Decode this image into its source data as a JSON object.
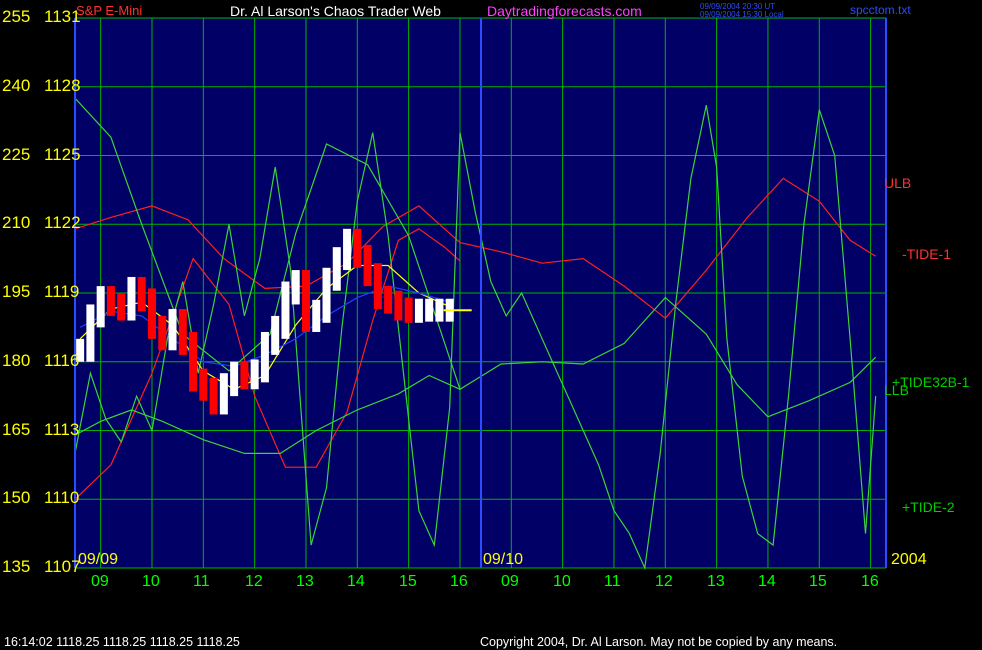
{
  "header": {
    "instrument": "S&P E-Mini",
    "title": "Dr. Al Larson's Chaos Trader Web",
    "site": "Daytradingforecasts.com",
    "stamp_line1": "09/09/2004 20:30 UT",
    "stamp_line2": "09/09/2004 15:30 Local",
    "filename": "spcctom.txt"
  },
  "footer": {
    "quote": "16:14:02  1118.25 1118.25 1118.25 1118.25",
    "copyright": "Copyright 2004, Dr. Al Larson. May not be copied by any means."
  },
  "colors": {
    "background": "#000000",
    "plot_area": "#000066",
    "grid": "#00b400",
    "tick_labels": "#ffff00",
    "time_labels": "#00ff00",
    "price_bars_up": "#ffffff",
    "price_bars_down": "#ff0000",
    "band": "#ff2020",
    "tide": "#3cd23c",
    "moving_avg": "#ffff00",
    "blue_line": "#2040ff"
  },
  "chart_data": {
    "type": "line",
    "title": "Dr. Al Larson's Chaos Trader Web",
    "y_label_pairs": [
      {
        "left": "255",
        "price": "1131"
      },
      {
        "left": "240",
        "price": "1128"
      },
      {
        "left": "225",
        "price": "1125"
      },
      {
        "left": "210",
        "price": "1122"
      },
      {
        "left": "195",
        "price": "1119"
      },
      {
        "left": "180",
        "price": "1116"
      },
      {
        "left": "165",
        "price": "1113"
      },
      {
        "left": "150",
        "price": "1110"
      },
      {
        "left": "135",
        "price": "1107"
      }
    ],
    "ylim": [
      1107,
      1131
    ],
    "xlim": [
      8.5,
      24.3
    ],
    "x_tick_labels": [
      {
        "x": 9,
        "label": "09"
      },
      {
        "x": 10,
        "label": "10"
      },
      {
        "x": 11,
        "label": "11"
      },
      {
        "x": 12,
        "label": "12"
      },
      {
        "x": 13,
        "label": "13"
      },
      {
        "x": 14,
        "label": "14"
      },
      {
        "x": 15,
        "label": "15"
      },
      {
        "x": 16,
        "label": "16"
      },
      {
        "x": 17,
        "label": "09"
      },
      {
        "x": 18,
        "label": "10"
      },
      {
        "x": 19,
        "label": "11"
      },
      {
        "x": 20,
        "label": "12"
      },
      {
        "x": 21,
        "label": "13"
      },
      {
        "x": 22,
        "label": "14"
      },
      {
        "x": 23,
        "label": "15"
      },
      {
        "x": 24,
        "label": "16"
      }
    ],
    "date_labels": {
      "day1": "09/09",
      "day2": "09/10",
      "year": "2004"
    },
    "day_divider_x": 16,
    "current_price": 1118.25,
    "price_bars": {
      "x": [
        8.6,
        8.8,
        9.0,
        9.2,
        9.4,
        9.6,
        9.8,
        10.0,
        10.2,
        10.4,
        10.6,
        10.8,
        11.0,
        11.2,
        11.4,
        11.6,
        11.8,
        12.0,
        12.2,
        12.4,
        12.6,
        12.8,
        13.0,
        13.2,
        13.4,
        13.6,
        13.8,
        14.0,
        14.2,
        14.4,
        14.6,
        14.8,
        15.0,
        15.2,
        15.4,
        15.6,
        15.8
      ],
      "close": [
        1116.5,
        1118.0,
        1118.8,
        1118.5,
        1118.3,
        1119.2,
        1118.7,
        1117.5,
        1117.0,
        1117.8,
        1116.8,
        1115.2,
        1114.8,
        1114.2,
        1115.0,
        1115.5,
        1115.3,
        1115.6,
        1116.8,
        1117.5,
        1119.0,
        1119.5,
        1117.8,
        1118.2,
        1119.6,
        1120.5,
        1121.3,
        1120.6,
        1119.8,
        1118.8,
        1118.6,
        1118.3,
        1118.2,
        1118.25,
        1118.25,
        1118.25,
        1118.25
      ]
    },
    "series": [
      {
        "name": "ULB",
        "x": [
          8.5,
          9.2,
          10.0,
          10.7,
          11.4,
          12.2,
          13.0,
          13.8,
          14.5,
          15.2,
          16.0,
          16.8,
          17.6,
          18.4,
          19.2,
          20.0,
          20.8,
          21.6,
          22.3,
          23.0,
          23.6,
          24.1
        ],
        "y": [
          1121.8,
          1122.3,
          1122.8,
          1122.2,
          1120.5,
          1119.2,
          1119.3,
          1120.3,
          1121.9,
          1122.8,
          1121.2,
          1120.8,
          1120.3,
          1120.5,
          1119.3,
          1117.9,
          1120.0,
          1122.3,
          1124.0,
          1123.0,
          1121.3,
          1120.6
        ]
      },
      {
        "name": "LLB",
        "x": [
          8.5,
          9.2,
          10.0,
          10.8,
          11.5,
          12.0,
          12.6,
          13.2,
          13.8,
          14.3,
          14.8,
          15.2,
          15.7,
          16.0
        ],
        "y": [
          1110.0,
          1111.5,
          1115.5,
          1120.5,
          1118.5,
          1114.5,
          1111.4,
          1111.4,
          1113.8,
          1117.8,
          1121.3,
          1121.8,
          1121.0,
          1120.4
        ]
      },
      {
        "name": "-TIDE-1",
        "x": [
          8.5,
          9.2,
          9.8,
          10.6,
          11.5,
          12.3,
          12.8,
          13.4,
          14.2,
          15.0,
          15.6,
          16.0,
          16.8,
          17.6,
          18.4,
          19.2,
          20.0,
          20.8,
          21.4,
          22.0,
          22.8,
          23.6,
          24.1
        ],
        "y": [
          1127.5,
          1125.8,
          1122.0,
          1117.2,
          1115.6,
          1117.2,
          1121.6,
          1125.5,
          1124.6,
          1121.5,
          1117.5,
          1114.8,
          1115.9,
          1116.0,
          1115.9,
          1116.8,
          1118.8,
          1117.2,
          1115.0,
          1113.6,
          1114.3,
          1115.1,
          1116.2
        ]
      },
      {
        "name": "+TIDE-2",
        "x": [
          8.5,
          9.0,
          9.6,
          10.2,
          11.0,
          11.8,
          12.5,
          13.2,
          14.0,
          14.8,
          15.4,
          16.0
        ],
        "y": [
          1112.8,
          1113.4,
          1113.9,
          1113.4,
          1112.6,
          1112.0,
          1112.0,
          1113.0,
          1113.9,
          1114.6,
          1115.4,
          1114.8
        ]
      },
      {
        "name": "+TIDE32B-1",
        "x": [
          8.5,
          8.8,
          9.1,
          9.4,
          9.7,
          10.0,
          10.3,
          10.6,
          10.9,
          11.2,
          11.5,
          11.8,
          12.1,
          12.4,
          12.7,
          12.9,
          13.1,
          13.4,
          13.7,
          14.0,
          14.3,
          14.6,
          14.9,
          15.2,
          15.5,
          15.8,
          16.0,
          16.3,
          16.6,
          16.9,
          17.2,
          17.5,
          17.8,
          18.1,
          18.4,
          18.7,
          19.0,
          19.3,
          19.6,
          19.9,
          20.2,
          20.5,
          20.8,
          21.0,
          21.2,
          21.5,
          21.8,
          22.1,
          22.4,
          22.7,
          23.0,
          23.3,
          23.6,
          23.9,
          24.1
        ],
        "y": [
          1112.0,
          1115.5,
          1113.5,
          1112.5,
          1114.5,
          1113.0,
          1117.0,
          1119.5,
          1115.5,
          1118.5,
          1122.0,
          1118.0,
          1120.5,
          1124.5,
          1120.0,
          1114.0,
          1108.0,
          1110.5,
          1117.5,
          1123.0,
          1126.0,
          1121.5,
          1115.5,
          1109.5,
          1108.0,
          1114.0,
          1126.0,
          1122.5,
          1119.5,
          1118.0,
          1119.0,
          1117.5,
          1116.0,
          1114.5,
          1113.0,
          1111.5,
          1109.5,
          1108.5,
          1107.0,
          1112.0,
          1118.5,
          1124.0,
          1127.2,
          1124.5,
          1117.0,
          1111.0,
          1108.5,
          1108.0,
          1114.5,
          1122.0,
          1127.0,
          1125.0,
          1117.0,
          1108.5,
          1114.5
        ]
      },
      {
        "name": "average",
        "x": [
          8.6,
          9.2,
          9.8,
          10.4,
          11.0,
          11.6,
          12.2,
          12.8,
          13.4,
          14.0,
          14.6,
          15.2,
          15.8
        ],
        "y": [
          1117.0,
          1118.3,
          1118.6,
          1117.6,
          1115.6,
          1114.8,
          1115.4,
          1117.6,
          1119.2,
          1120.2,
          1120.2,
          1119.0,
          1118.4
        ]
      },
      {
        "name": "blue",
        "x": [
          8.6,
          9.2,
          9.8,
          10.4,
          11.0,
          11.6,
          12.2,
          12.8,
          13.4,
          14.0,
          14.6,
          15.2,
          15.8
        ],
        "y": [
          1117.5,
          1118.2,
          1118.0,
          1117.0,
          1116.0,
          1115.8,
          1116.3,
          1117.0,
          1118.0,
          1118.8,
          1119.3,
          1119.0,
          1118.6
        ]
      }
    ],
    "right_labels": [
      {
        "name": "ULB",
        "color": "#ff3030"
      },
      {
        "name": "-TIDE-1",
        "color": "#ff3030"
      },
      {
        "name": "+TIDE32B-1",
        "color": "#00cc00"
      },
      {
        "name": "LLB",
        "color": "#00cc00"
      },
      {
        "name": "+TIDE-2",
        "color": "#00cc00"
      }
    ]
  }
}
